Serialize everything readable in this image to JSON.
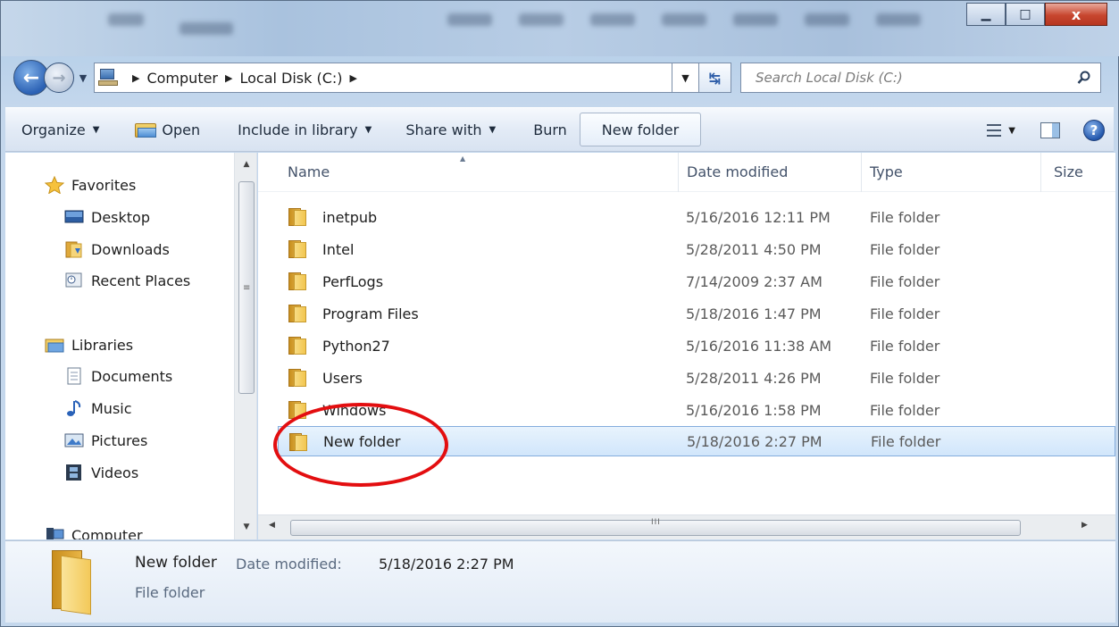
{
  "address": {
    "crumbs": [
      "Computer",
      "Local Disk (C:)"
    ],
    "search_placeholder": "Search Local Disk (C:)"
  },
  "toolbar": {
    "organize": "Organize",
    "open": "Open",
    "include": "Include in library",
    "share": "Share with",
    "burn": "Burn",
    "new_folder": "New folder"
  },
  "nav": {
    "favorites": "Favorites",
    "desktop": "Desktop",
    "downloads": "Downloads",
    "recent": "Recent Places",
    "libraries": "Libraries",
    "documents": "Documents",
    "music": "Music",
    "pictures": "Pictures",
    "videos": "Videos",
    "computer": "Computer"
  },
  "columns": {
    "name": "Name",
    "date": "Date modified",
    "type": "Type",
    "size": "Size"
  },
  "files": [
    {
      "name": "inetpub",
      "date": "5/16/2016 12:11 PM",
      "type": "File folder"
    },
    {
      "name": "Intel",
      "date": "5/28/2011 4:50 PM",
      "type": "File folder"
    },
    {
      "name": "PerfLogs",
      "date": "7/14/2009 2:37 AM",
      "type": "File folder"
    },
    {
      "name": "Program Files",
      "date": "5/18/2016 1:47 PM",
      "type": "File folder"
    },
    {
      "name": "Python27",
      "date": "5/16/2016 11:38 AM",
      "type": "File folder"
    },
    {
      "name": "Users",
      "date": "5/28/2011 4:26 PM",
      "type": "File folder"
    },
    {
      "name": "Windows",
      "date": "5/16/2016 1:58 PM",
      "type": "File folder"
    },
    {
      "name": "New folder",
      "date": "5/18/2016 2:27 PM",
      "type": "File folder",
      "selected": true
    }
  ],
  "details": {
    "name": "New folder",
    "date_label": "Date modified:",
    "date": "5/18/2016 2:27 PM",
    "type": "File folder"
  },
  "colors": {
    "annotation": "#e30e10",
    "selection": "#d1e6fb"
  },
  "scrollbar_grip": "III",
  "window_close": "x"
}
